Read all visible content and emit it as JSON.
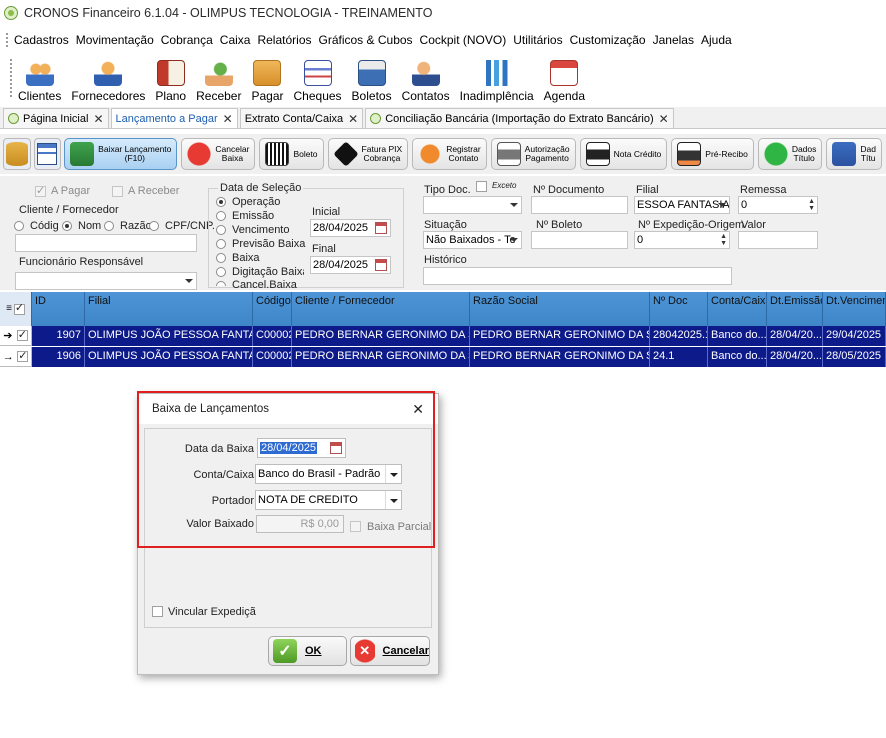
{
  "window": {
    "title": "CRONOS Financeiro 6.1.04 - OLIMPUS TECNOLOGIA - TREINAMENTO"
  },
  "menu": [
    "Cadastros",
    "Movimentação",
    "Cobrança",
    "Caixa",
    "Relatórios",
    "Gráficos & Cubos",
    "Cockpit (NOVO)",
    "Utilitários",
    "Customização",
    "Janelas",
    "Ajuda"
  ],
  "toolbar": [
    "Clientes",
    "Fornecedores",
    "Plano",
    "Receber",
    "Pagar",
    "Cheques",
    "Boletos",
    "Contatos",
    "Inadimplência",
    "Agenda"
  ],
  "tabs": [
    {
      "label": "Página Inicial"
    },
    {
      "label": "Lançamento a Pagar"
    },
    {
      "label": "Extrato Conta/Caixa"
    },
    {
      "label": "Conciliação Bancária (Importação do Extrato Bancário)"
    }
  ],
  "actions": {
    "baixar": [
      "Baixar Lançamento",
      "(F10)"
    ],
    "cancelar": [
      "Cancelar",
      "Baixa"
    ],
    "boleto": "Boleto",
    "pix": [
      "Fatura PIX",
      "Cobrança"
    ],
    "registrar": [
      "Registrar",
      "Contato"
    ],
    "autorizacao": [
      "Autorização",
      "Pagamento"
    ],
    "nota": "Nota Crédito",
    "prerecibo": "Pré-Recibo",
    "dados": [
      "Dados",
      "Título"
    ],
    "dados2": [
      "Dad",
      "Títu"
    ]
  },
  "filters": {
    "a_pagar": "A Pagar",
    "a_receber": "A Receber",
    "cliente_fornecedor": "Cliente / Fornecedor",
    "radio_codigo": "Códig",
    "radio_nome": "Nom",
    "radio_razao": "Razão",
    "radio_cpf": "CPF/CNP.",
    "funcionario": "Funcionário Responsável",
    "data_selecao": "Data de Seleção",
    "date_options": [
      "Operação",
      "Emissão",
      "Vencimento",
      "Previsão Baixa",
      "Baixa",
      "Digitação Baixa",
      "Cancel.Baixa"
    ],
    "inicial_label": "Inicial",
    "inicial": "28/04/2025",
    "final_label": "Final",
    "final": "28/04/2025",
    "tipo_doc": "Tipo Doc.",
    "exceto": "Exceto",
    "n_documento": "Nº Documento",
    "filial": "Filial",
    "filial_value": "ESSOA FANTASIA",
    "remessa": "Remessa",
    "remessa_value": "0",
    "situacao": "Situação",
    "situacao_value": "Não Baixados - Te",
    "n_boleto": "Nº Boleto",
    "n_expedicao": "Nº Expedição-Origem",
    "expedicao_value": "0",
    "valor": "Valor",
    "historico": "Histórico"
  },
  "grid": {
    "headers": [
      "ID",
      "Filial",
      "Código",
      "Cliente / Fornecedor",
      "Razão Social",
      "Nº Doc",
      "Conta/Caixa",
      "Dt.Emissão",
      "Dt.Vencimento"
    ],
    "rows": [
      {
        "id": "1907",
        "filial": "OLIMPUS JOÃO PESSOA FANTASIA",
        "codigo": "C00002",
        "cliente": "PEDRO BERNAR GERONIMO DA SIL...",
        "razao": "PEDRO BERNAR GERONIMO DA SIL...",
        "doc": "28042025.1",
        "conta": "Banco do...",
        "emissao": "28/04/20...",
        "vencimento": "29/04/2025"
      },
      {
        "id": "1906",
        "filial": "OLIMPUS JOÃO PESSOA FANTASIA",
        "codigo": "C00002",
        "cliente": "PEDRO BERNAR GERONIMO DA SIL...",
        "razao": "PEDRO BERNAR GERONIMO DA SIL...",
        "doc": "24.1",
        "conta": "Banco do...",
        "emissao": "28/04/20...",
        "vencimento": "28/05/2025"
      }
    ]
  },
  "dialog": {
    "title": "Baixa de Lançamentos",
    "data_baixa_label": "Data da Baixa",
    "data_baixa": "28/04/2025",
    "conta_label": "Conta/Caixa",
    "conta": "Banco do Brasil - Padrão",
    "portador_label": "Portador",
    "portador": "NOTA DE CREDITO",
    "valor_label": "Valor Baixado",
    "valor": "R$ 0,00",
    "baixa_parcial": "Baixa Parcial",
    "vincular": "Vincular Expedição",
    "ok": "OK",
    "cancelar": "Cancelar"
  },
  "colors": {
    "grid_header": "#4d95d6",
    "grid_row_selected": "#0d1a8a",
    "highlight": "#e0201e"
  }
}
